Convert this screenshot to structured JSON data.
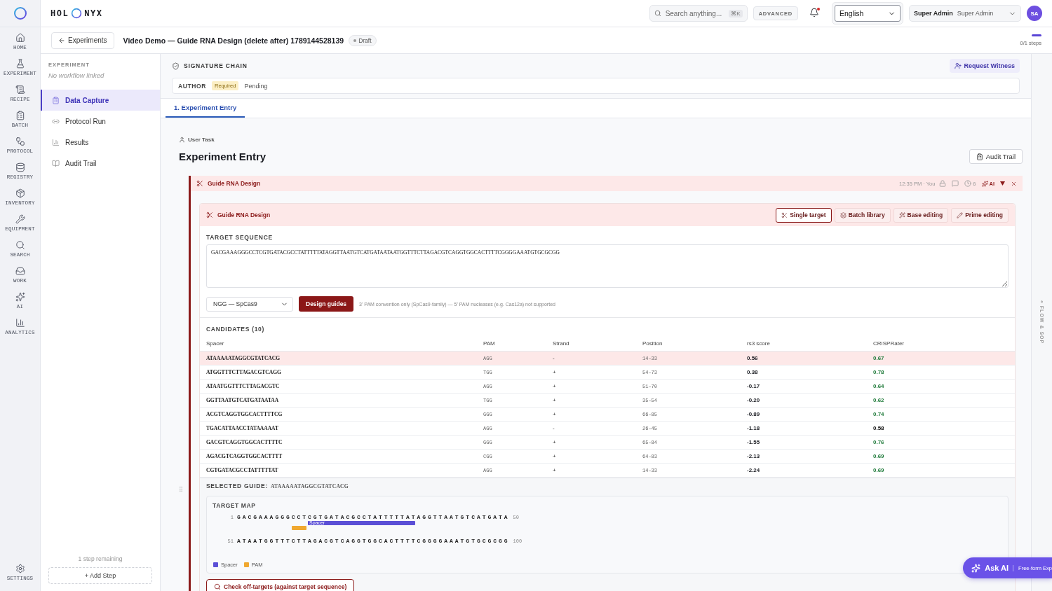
{
  "brand": {
    "left": "HOL",
    "right": "NYX"
  },
  "header": {
    "search": {
      "placeholder": "Search anything...",
      "shortcut": "⌘K"
    },
    "advanced": "ADVANCED",
    "unread": true,
    "language": "English",
    "user": {
      "name": "Super Admin",
      "role": "Super Admin",
      "initials": "SA"
    }
  },
  "rail": {
    "items": [
      {
        "label": "HOME",
        "selected": false
      },
      {
        "label": "EXPERIMENT",
        "selected": false
      },
      {
        "label": "RECIPE",
        "selected": false
      },
      {
        "label": "BATCH",
        "selected": false
      },
      {
        "label": "PROTOCOL",
        "selected": false
      },
      {
        "label": "REGISTRY",
        "selected": false
      },
      {
        "label": "INVENTORY",
        "selected": false
      },
      {
        "label": "EQUIPMENT",
        "selected": false
      },
      {
        "label": "SEARCH",
        "selected": false
      },
      {
        "label": "WORK",
        "selected": false
      },
      {
        "label": "AI",
        "selected": false
      },
      {
        "label": "ANALYTICS",
        "selected": false
      }
    ],
    "settings": "SETTINGS"
  },
  "breadcrumb": {
    "back": "Experiments",
    "title": "Video Demo — Guide RNA Design (delete after) 1789144528139",
    "status": "Draft",
    "steps": "0/1 steps"
  },
  "steps_panel": {
    "heading": "EXPERIMENT",
    "subtitle": "No workflow linked",
    "items": [
      {
        "label": "Data Capture",
        "selected": true
      },
      {
        "label": "Protocol Run",
        "selected": false
      },
      {
        "label": "Results",
        "selected": false
      },
      {
        "label": "Audit Trail",
        "selected": false
      }
    ],
    "remaining": "1 step remaining",
    "add_step": "+ Add Step"
  },
  "signature_chain": {
    "title": "SIGNATURE CHAIN",
    "request": "Request Witness",
    "entries": [
      {
        "role": "AUTHOR",
        "badge": "Required",
        "status": "Pending"
      }
    ]
  },
  "tabs": [
    {
      "label": "1. Experiment Entry",
      "selected": true
    }
  ],
  "task": {
    "type": "User Task",
    "title": "Experiment Entry",
    "audit": "Audit Trail"
  },
  "block": {
    "title": "Guide RNA Design",
    "meta": "12:35 PM · You",
    "history_count": "6",
    "ai": "AI",
    "tool": {
      "title": "Guide RNA Design",
      "modes": [
        {
          "label": "Single target",
          "selected": true
        },
        {
          "label": "Batch library",
          "selected": false
        },
        {
          "label": "Base editing",
          "selected": false
        },
        {
          "label": "Prime editing",
          "selected": false
        }
      ],
      "target_label": "TARGET SEQUENCE",
      "sequence": "GACGAAAGGGCCTCGTGATACGCCTATTTTTATAGGTTAATGTCATGATAATAATGGTTTCTTAGACGTCAGGTGGCACTTTTCGGGGAAATGTGCGCGG",
      "nuclease": "NGG — SpCas9",
      "design": "Design guides",
      "note": "3' PAM convention only (SpCas9-family) — 5' PAM nucleases (e.g. Cas12a) not supported",
      "candidates_title": "CANDIDATES (10)",
      "columns": [
        "Spacer",
        "PAM",
        "Strand",
        "Position",
        "rs3 score",
        "CRISPRater"
      ],
      "rows": [
        {
          "selected": true,
          "cells": [
            "ATAAAAATAGGCGTATCACG",
            "AGG",
            "-",
            "14–33",
            "0.56",
            "0.67"
          ],
          "color": "#1f7a3a"
        },
        {
          "selected": false,
          "cells": [
            "ATGGTTTCTTAGACGTCAGG",
            "TGG",
            "+",
            "54–73",
            "0.38",
            "0.78"
          ],
          "color": "#1f7a3a"
        },
        {
          "selected": false,
          "cells": [
            "ATAATGGTTTCTTAGACGTC",
            "AGG",
            "+",
            "51–70",
            "-0.17",
            "0.64"
          ],
          "color": "#1f7a3a"
        },
        {
          "selected": false,
          "cells": [
            "GGTTAATGTCATGATAATAA",
            "TGG",
            "+",
            "35–54",
            "-0.20",
            "0.62"
          ],
          "color": "#1f7a3a"
        },
        {
          "selected": false,
          "cells": [
            "ACGTCAGGTGGCACTTTTCG",
            "GGG",
            "+",
            "66–85",
            "-0.89",
            "0.74"
          ],
          "color": "#1f7a3a"
        },
        {
          "selected": false,
          "cells": [
            "TGACATTAACCTATAAAAAT",
            "AGG",
            "-",
            "26–45",
            "-1.18",
            "0.58"
          ],
          "color": "#111111"
        },
        {
          "selected": false,
          "cells": [
            "GACGTCAGGTGGCACTTTTC",
            "GGG",
            "+",
            "65–84",
            "-1.55",
            "0.76"
          ],
          "color": "#1f7a3a"
        },
        {
          "selected": false,
          "cells": [
            "AGACGTCAGGTGGCACTTTT",
            "CGG",
            "+",
            "64–83",
            "-2.13",
            "0.69"
          ],
          "color": "#1f7a3a"
        },
        {
          "selected": false,
          "cells": [
            "CGTGATACGCCTATTTTTAT",
            "AGG",
            "+",
            "14–33",
            "-2.24",
            "0.69"
          ],
          "color": "#1f7a3a"
        }
      ],
      "selected_label": "SELECTED GUIDE:",
      "selected_guide": "ATAAAAATAGGCGTATCACG",
      "map": {
        "title": "TARGET MAP",
        "lines": [
          {
            "start": "1",
            "sequence": "GACGAAAGGGCCTCGTGATACGCCTATTTTTATAGGTTAATGTCATGATA",
            "end": "50",
            "spacer_label": "Spacer"
          },
          {
            "start": "51",
            "sequence": "ATAATGGTTTCTTAGACGTCAGGTGGCACTTTTCGGGGAAATGTGCGCGG",
            "end": "100"
          }
        ],
        "legend": [
          {
            "kind": "spacer",
            "label": "Spacer",
            "color": "#5b4fd6"
          },
          {
            "kind": "pam",
            "label": "PAM",
            "color": "#f0a830"
          }
        ]
      },
      "offtargets": "Check off-targets (against target sequence)"
    }
  },
  "side_strip": "« FLOW & SOP",
  "ask_ai": {
    "label": "Ask AI",
    "hint": "Free-form Exp"
  }
}
